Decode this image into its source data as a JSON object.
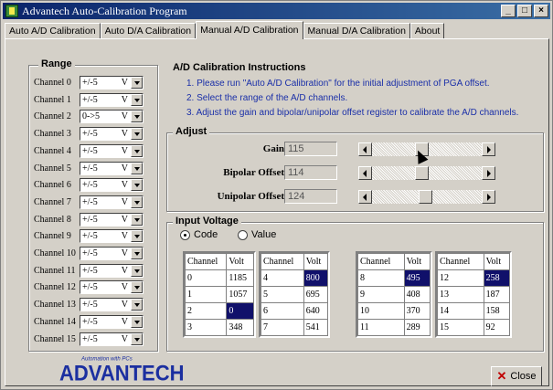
{
  "window": {
    "title": "Advantech Auto-Calibration Program",
    "min_label": "_",
    "max_label": "□",
    "close_label": "×"
  },
  "tabs": [
    {
      "label": "Auto A/D Calibration"
    },
    {
      "label": "Auto D/A Calibration"
    },
    {
      "label": "Manual A/D Calibration"
    },
    {
      "label": "Manual D/A Calibration"
    },
    {
      "label": "About"
    }
  ],
  "active_tab": 2,
  "range": {
    "title": "Range",
    "channels": [
      {
        "label": "Channel 0",
        "value": "+/-5",
        "unit": "V"
      },
      {
        "label": "Channel 1",
        "value": "+/-5",
        "unit": "V"
      },
      {
        "label": "Channel 2",
        "value": "0->5",
        "unit": "V"
      },
      {
        "label": "Channel 3",
        "value": "+/-5",
        "unit": "V"
      },
      {
        "label": "Channel 4",
        "value": "+/-5",
        "unit": "V"
      },
      {
        "label": "Channel 5",
        "value": "+/-5",
        "unit": "V"
      },
      {
        "label": "Channel 6",
        "value": "+/-5",
        "unit": "V"
      },
      {
        "label": "Channel 7",
        "value": "+/-5",
        "unit": "V"
      },
      {
        "label": "Channel 8",
        "value": "+/-5",
        "unit": "V"
      },
      {
        "label": "Channel 9",
        "value": "+/-5",
        "unit": "V"
      },
      {
        "label": "Channel 10",
        "value": "+/-5",
        "unit": "V"
      },
      {
        "label": "Channel 11",
        "value": "+/-5",
        "unit": "V"
      },
      {
        "label": "Channel 12",
        "value": "+/-5",
        "unit": "V"
      },
      {
        "label": "Channel 13",
        "value": "+/-5",
        "unit": "V"
      },
      {
        "label": "Channel 14",
        "value": "+/-5",
        "unit": "V"
      },
      {
        "label": "Channel 15",
        "value": "+/-5",
        "unit": "V"
      }
    ]
  },
  "instructions": {
    "title": "A/D Calibration Instructions",
    "steps": [
      "1. Please run \"Auto A/D Calibration\" for the initial adjustment of PGA offset.",
      "2. Select the range of the A/D channels.",
      "3. Adjust the gain and bipolar/unipolar offset register to calibrate the A/D channels."
    ]
  },
  "adjust": {
    "title": "Adjust",
    "gain": {
      "label": "Gain",
      "value": "115",
      "slider_level": 0.45
    },
    "bipolar": {
      "label": "Bipolar Offset",
      "value": "114",
      "slider_level": 0.45
    },
    "unipolar": {
      "label": "Unipolar Offset",
      "value": "124",
      "slider_level": 0.49
    }
  },
  "input_voltage": {
    "title": "Input Voltage",
    "mode_code": "Code",
    "mode_value": "Value",
    "selected_mode": "Code",
    "col_channel": "Channel",
    "col_volt": "Volt",
    "tables": [
      {
        "rows": [
          [
            "0",
            "1185"
          ],
          [
            "1",
            "1057"
          ],
          [
            "2",
            "0"
          ],
          [
            "3",
            "348"
          ]
        ],
        "selected_row": 2
      },
      {
        "rows": [
          [
            "4",
            "800"
          ],
          [
            "5",
            "695"
          ],
          [
            "6",
            "640"
          ],
          [
            "7",
            "541"
          ]
        ],
        "selected_row": 0
      },
      {
        "rows": [
          [
            "8",
            "495"
          ],
          [
            "9",
            "408"
          ],
          [
            "10",
            "370"
          ],
          [
            "11",
            "289"
          ]
        ],
        "selected_row": 0
      },
      {
        "rows": [
          [
            "12",
            "258"
          ],
          [
            "13",
            "187"
          ],
          [
            "14",
            "158"
          ],
          [
            "15",
            "92"
          ]
        ],
        "selected_row": 0
      }
    ]
  },
  "footer": {
    "logo_text": "ADVANTECH",
    "logo_tagline": "Automation with PCs",
    "close_button": "Close"
  }
}
